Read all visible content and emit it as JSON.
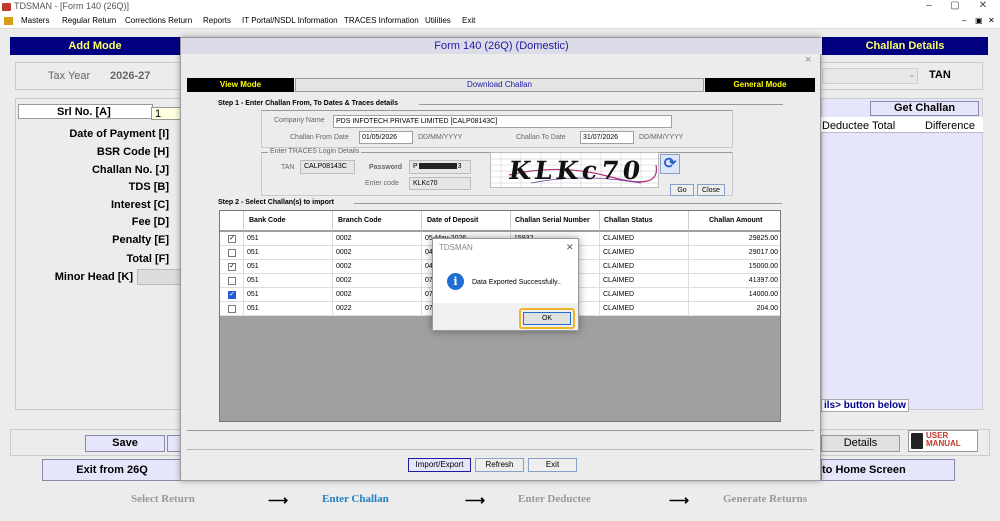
{
  "window": {
    "title": "TDSMAN - [Form 140 (26Q)]",
    "minimize": "–",
    "restore": "▢",
    "close": "✕",
    "child_min": "–",
    "child_restore": "▣",
    "child_close": "✕"
  },
  "menu": [
    "Masters",
    "Regular Return",
    "Corrections Return",
    "Reports",
    "IT Portal/NSDL Information",
    "TRACES Information",
    "Utilities",
    "Exit"
  ],
  "bg": {
    "tab_add_mode": "Add Mode",
    "tab_challan_details": "Challan Details",
    "tax_year_label": "Tax Year",
    "tax_year_value": "2026-27",
    "tan_label": "TAN",
    "srno_label": "Srl No. [A]",
    "srno_value": "1",
    "fields": [
      "Date of Payment [I]",
      "BSR Code [H]",
      "Challan No. [J]",
      "TDS [B]",
      "Interest [C]",
      "Fee [D]",
      "Penalty [E]",
      "Total [F]",
      "Minor Head [K]"
    ],
    "get_challan": "Get Challan",
    "col_deductee_total": "Deductee Total",
    "col_difference": "Difference",
    "hint_button_below": "ils> button below",
    "save": "Save",
    "details": "Details",
    "user_manual": "USER MANUAL",
    "exit_from": "Exit from 26Q",
    "to_home": "to Home Screen",
    "workflow": [
      "Select Return",
      "Enter Challan",
      "Enter Deductee",
      "Generate Returns"
    ]
  },
  "modal": {
    "title": "Form 140 (26Q) (Domestic)",
    "close": "×",
    "view_mode": "View Mode",
    "download_challan": "Download Challan",
    "general_mode": "General Mode",
    "step1": "Step 1 - Enter Challan From, To Dates & Traces details",
    "company_label": "Company Name",
    "company_value": "PDS INFOTECH PRIVATE LIMITED [CALP08143C]",
    "from_label": "Challan From Date",
    "from_value": "01/05/2026",
    "date_fmt": "DD/MM/YYYY",
    "to_label": "Challan To Date",
    "to_value": "31/07/2026",
    "traces_legend": "Enter TRACES Login Details",
    "tan_label": "TAN",
    "tan_value": "CALP08143C",
    "password_label": "Password",
    "password_value": "P",
    "password_tail": "3",
    "code_label": "Enter code",
    "code_value": "KLKc70",
    "captcha_text": "KLKc70",
    "go": "Go",
    "close_btn": "Close",
    "step2": "Step 2 - Select Challan(s) to import",
    "columns": [
      "Bank Code",
      "Branch Code",
      "Date of Deposit",
      "Challan Serial Number",
      "Challan Status",
      "Challan Amount"
    ],
    "rows": [
      {
        "checked": "✓",
        "bank": "051",
        "branch": "0002",
        "date": "05-May-2026",
        "serial": "15932",
        "status": "CLAIMED",
        "amount": "29825.00"
      },
      {
        "checked": "",
        "bank": "051",
        "branch": "0002",
        "date": "04",
        "serial": "",
        "status": "CLAIMED",
        "amount": "29017.00"
      },
      {
        "checked": "✓",
        "bank": "051",
        "branch": "0002",
        "date": "04",
        "serial": "",
        "status": "CLAIMED",
        "amount": "15000.00"
      },
      {
        "checked": "",
        "bank": "051",
        "branch": "0002",
        "date": "07",
        "serial": "",
        "status": "CLAIMED",
        "amount": "41397.00"
      },
      {
        "checked": "✓",
        "bank": "051",
        "branch": "0002",
        "date": "07",
        "serial": "",
        "status": "CLAIMED",
        "amount": "14000.00"
      },
      {
        "checked": "",
        "bank": "051",
        "branch": "0022",
        "date": "07",
        "serial": "",
        "status": "CLAIMED",
        "amount": "204.00"
      }
    ],
    "import_export": "Import/Export",
    "refresh": "Refresh",
    "exit": "Exit"
  },
  "dialog": {
    "title": "TDSMAN",
    "close": "✕",
    "icon": "i",
    "message": "Data Exported Successfully..",
    "ok": "OK"
  },
  "colors": {
    "navy": "#000080",
    "yellow_text": "#ffff66",
    "ok_highlight": "#f0b429",
    "selected_row": "#2a5bd7"
  }
}
